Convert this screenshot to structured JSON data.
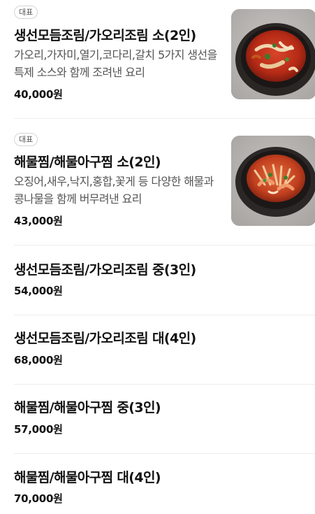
{
  "items": [
    {
      "badge": "대표",
      "name": "생선모듬조림/가오리조림 소(2인)",
      "description": "가오리,가자미,열기,코다리,갈치 5가지 생선을 특제 소스와 함께 조려낸 요리",
      "price": "40,000원",
      "image_icon": "braised-fish-dish-photo"
    },
    {
      "badge": "대표",
      "name": "해물찜/해물아구찜 소(2인)",
      "description": "오징어,새우,낙지,홍합,꽃게 등 다양한 해물과 콩나물을 함께 버무려낸 요리",
      "price": "43,000원",
      "image_icon": "seafood-stew-dish-photo"
    },
    {
      "name": "생선모듬조림/가오리조림 중(3인)",
      "price": "54,000원"
    },
    {
      "name": "생선모듬조림/가오리조림 대(4인)",
      "price": "68,000원"
    },
    {
      "name": "해물찜/해물아구찜 중(3인)",
      "price": "57,000원"
    },
    {
      "name": "해물찜/해물아구찜 대(4인)",
      "price": "70,000원"
    }
  ]
}
